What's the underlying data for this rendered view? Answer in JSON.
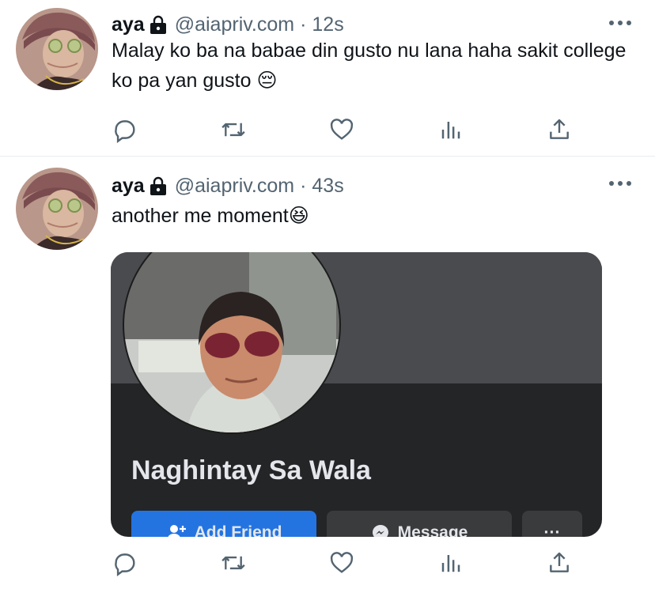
{
  "tweets": [
    {
      "author": {
        "display_name": "aya",
        "handle": "@aiapriv.com",
        "protected": true
      },
      "separator": "·",
      "time": "12s",
      "text": "Malay ko ba na babae din gusto nu lana haha sakit college ko pa yan gusto 😔",
      "actions": [
        "reply-icon",
        "retweet-icon",
        "like-icon",
        "views-icon",
        "share-icon"
      ]
    },
    {
      "author": {
        "display_name": "aya",
        "handle": "@aiapriv.com",
        "protected": true
      },
      "separator": "·",
      "time": "43s",
      "text": "another me moment😆",
      "media": {
        "profile_name": "Naghintay Sa Wala",
        "buttons": {
          "add_friend": "Add Friend",
          "message": "Message",
          "more": "···"
        }
      },
      "actions": [
        "reply-icon",
        "retweet-icon",
        "like-icon",
        "views-icon",
        "share-icon"
      ]
    }
  ],
  "colors": {
    "text_primary": "#0f1419",
    "text_secondary": "#536471",
    "divider": "#e6ecf0",
    "fb_blue": "#2374e1",
    "fb_dark": "#242526"
  }
}
